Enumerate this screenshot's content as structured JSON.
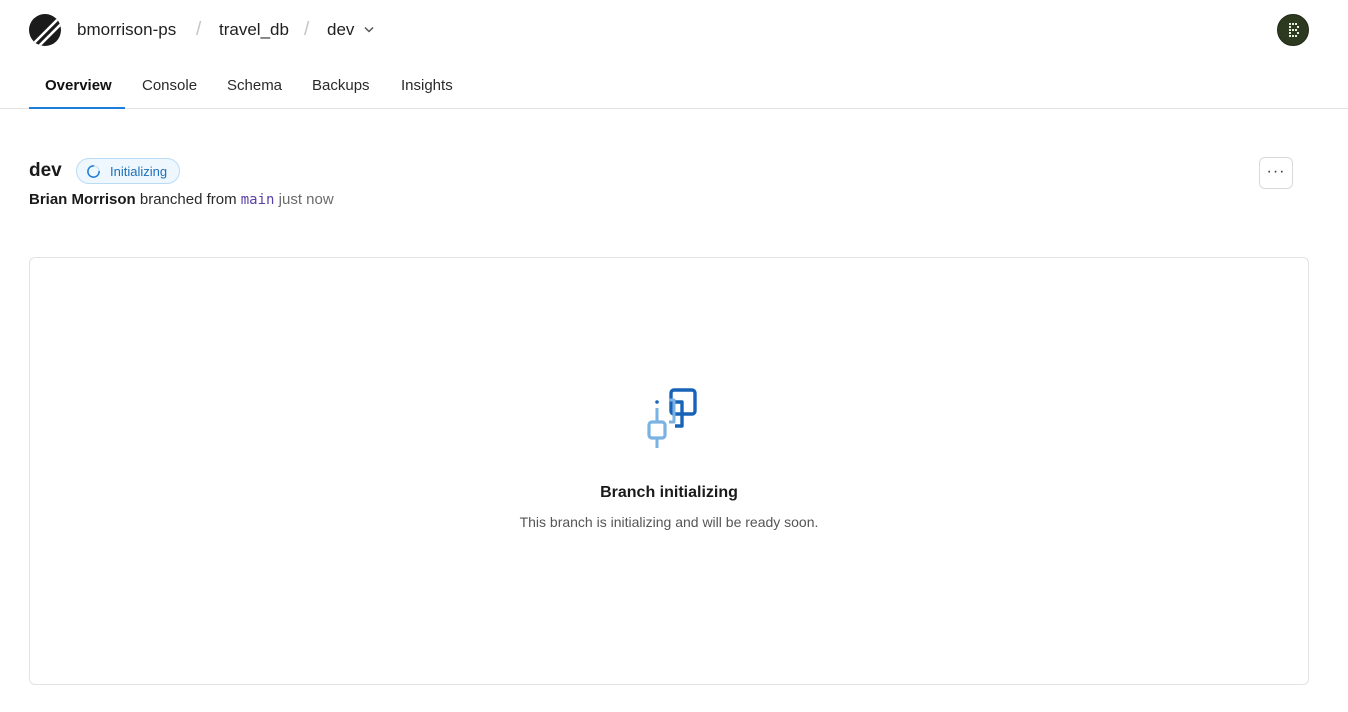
{
  "header": {
    "org": "bmorrison-ps",
    "database": "travel_db",
    "branch": "dev",
    "separator": "/",
    "logo_icon": "planetscale-logo-icon",
    "dropdown_icon": "chevron-down-icon",
    "avatar_icon": "user-avatar-icon"
  },
  "tabs": [
    {
      "label": "Overview",
      "active": true
    },
    {
      "label": "Console",
      "active": false
    },
    {
      "label": "Schema",
      "active": false
    },
    {
      "label": "Backups",
      "active": false
    },
    {
      "label": "Insights",
      "active": false
    }
  ],
  "branch": {
    "name": "dev",
    "status": "Initializing",
    "author": "Brian Morrison",
    "action_text": "branched from",
    "parent": "main",
    "time": "just now",
    "more_label": "···"
  },
  "empty_state": {
    "icon": "branch-icon",
    "title": "Branch initializing",
    "subtitle": "This branch is initializing and will be ready soon."
  },
  "colors": {
    "accent": "#1e7fd9",
    "badge_text": "#1e6fb8",
    "badge_bg": "#eef7fd",
    "code": "#5b3fa8"
  }
}
